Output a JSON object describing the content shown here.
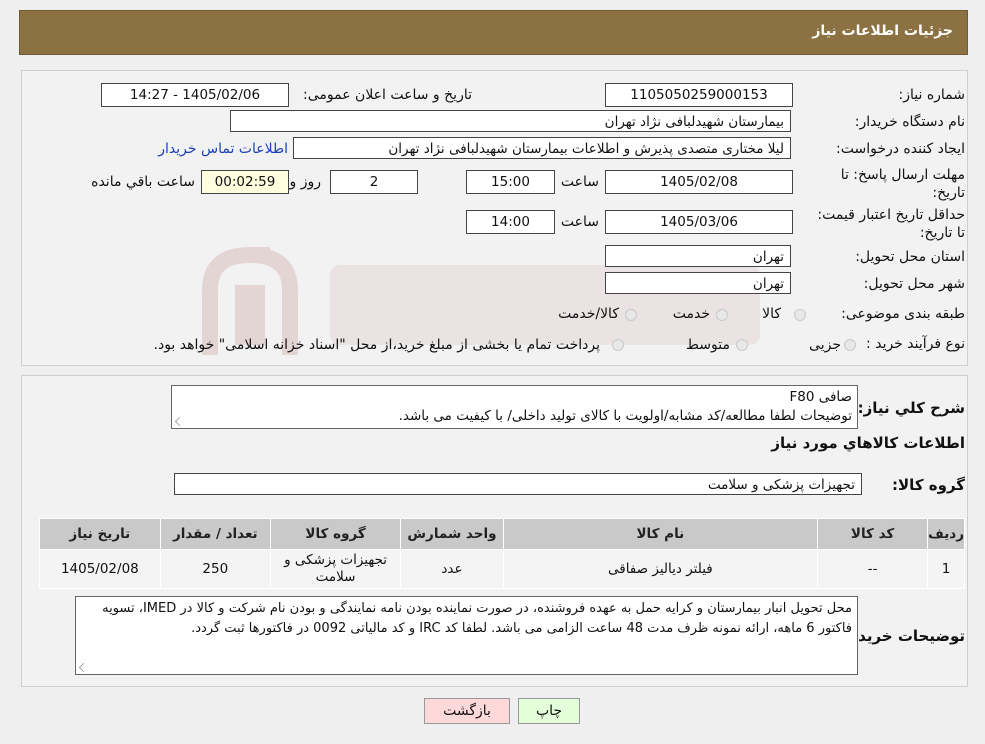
{
  "header": {
    "title": "جزئیات اطلاعات نیاز"
  },
  "form": {
    "need_number": {
      "label": "شماره نیاز:",
      "value": "1105050259000153"
    },
    "announce": {
      "label": "تاریخ و ساعت اعلان عمومی:",
      "value": "1405/02/06 - 14:27"
    },
    "buyer": {
      "label": "نام دستگاه خریدار:",
      "value": "بیمارستان شهیدلبافی نژاد تهران"
    },
    "creator": {
      "label": "ایجاد کننده درخواست:",
      "value": "لیلا مختاری متصدی پذیرش و اطلاعات بیمارستان شهیدلبافی نژاد تهران",
      "contact_link": "اطلاعات تماس خریدار"
    },
    "reply_deadline": {
      "label": "مهلت ارسال پاسخ: تا تاریخ:",
      "date": "1405/02/08",
      "time_label": "ساعت",
      "time": "15:00",
      "days": "2",
      "days_label": "روز و",
      "remaining": "00:02:59",
      "remaining_label": "ساعت باقي مانده"
    },
    "price_validity": {
      "label": "حداقل تاریخ اعتبار قیمت: تا تاریخ:",
      "date": "1405/03/06",
      "time_label": "ساعت",
      "time": "14:00"
    },
    "province": {
      "label": "استان محل تحویل:",
      "value": "تهران"
    },
    "city": {
      "label": "شهر محل تحویل:",
      "value": "تهران"
    },
    "category": {
      "label": "طبقه بندی موضوعی:",
      "options": [
        "کالا",
        "خدمت",
        "کالا/خدمت"
      ]
    },
    "purchase_type": {
      "label": "نوع فرآیند خرید :",
      "options": [
        "جزیی",
        "متوسط"
      ],
      "note": "پرداخت تمام یا بخشی از مبلغ خرید،از محل \"اسناد خزانه اسلامی\" خواهد بود."
    }
  },
  "summary": {
    "label": "شرح کلي نياز:",
    "line1": "صافی F80",
    "line2": "توضیحات لطفا مطالعه/کد مشابه/اولویت با کالای تولید داخلی/ با کیفیت می باشد."
  },
  "goods": {
    "title": "اطلاعات کالاهاي مورد نياز",
    "group_label": "گروه کالا:",
    "group_value": "تجهیزات پزشکی و سلامت",
    "columns": [
      "رديف",
      "کد کالا",
      "نام کالا",
      "واحد شمارش",
      "گروه کالا",
      "تعداد / مقدار",
      "تاريخ نياز"
    ],
    "rows": [
      [
        "1",
        "--",
        "فیلتر دیالیز صفاقی",
        "عدد",
        "تجهیزات پزشکی و سلامت",
        "250",
        "1405/02/08"
      ]
    ]
  },
  "buyer_notes": {
    "label": "توضیحات خریدار:",
    "text": "محل تحویل انبار بیمارستان و کرایه حمل به عهده فروشنده، در صورت نماینده بودن نامه نمایندگی و بودن نام شرکت و کالا در IMED، تسویه فاکتور 6 ماهه، ارائه نمونه ظرف مدت 48 ساعت الزامی می باشد. لطفا کد IRC و کد مالیاتی 0092 در فاکتورها ثبت گردد."
  },
  "buttons": {
    "print": "چاپ",
    "back": "بازگشت"
  },
  "colors": {
    "header": "#8c7242",
    "back_button": "#ffd9d9",
    "print_button": "#e3ffd9"
  }
}
